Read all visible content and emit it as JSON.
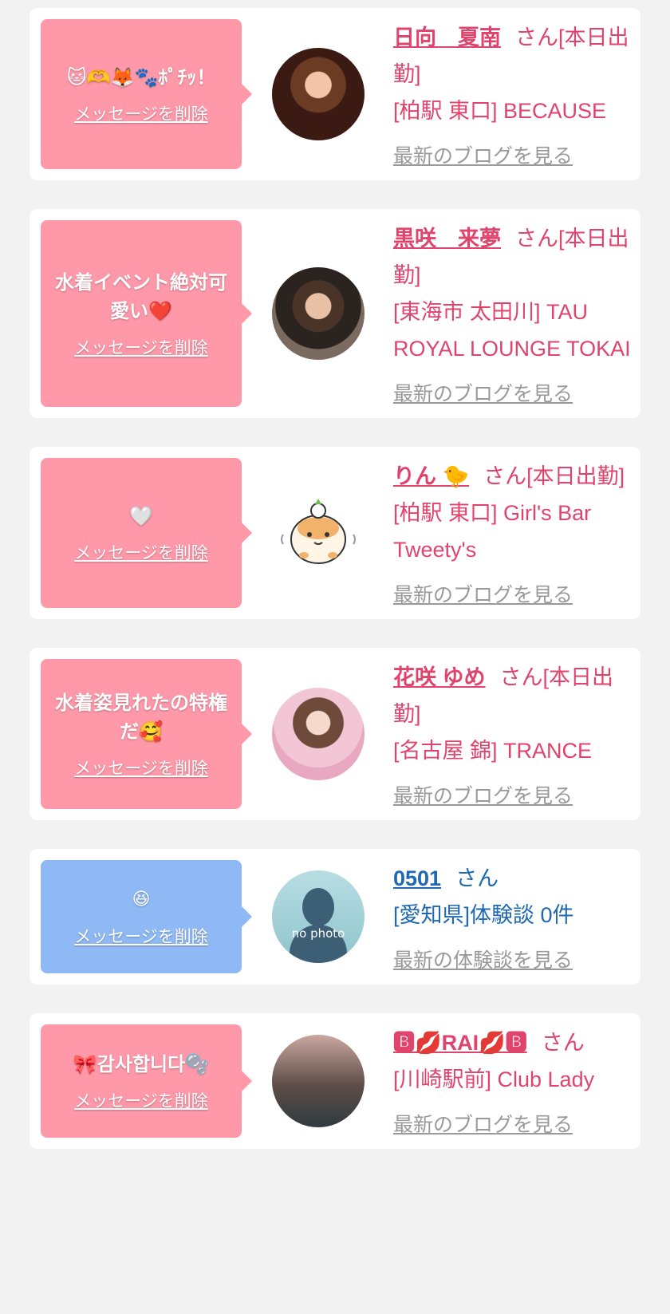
{
  "cards": [
    {
      "bubble_color": "pink",
      "message": "🐱🫶🦊🐾ﾎﾟﾁｯ！",
      "delete_label": "メッセージを削除",
      "avatar_icon": "profile-photo",
      "name": "日向　夏南",
      "suffix": "さん[本日出勤]",
      "shop": "[柏駅 東口] BECAUSE",
      "link": "最新のブログを見る"
    },
    {
      "bubble_color": "pink",
      "message": "水着イベント絶対可愛い❤️",
      "delete_label": "メッセージを削除",
      "avatar_icon": "profile-photo",
      "name": "黒咲　来夢",
      "suffix": "さん[本日出勤]",
      "shop": "[東海市 太田川] TAU ROYAL LOUNGE TOKAI",
      "link": "最新のブログを見る"
    },
    {
      "bubble_color": "pink",
      "message": "🤍",
      "delete_label": "メッセージを削除",
      "avatar_icon": "hamster-mascot",
      "name": "りん 🐤",
      "suffix": "さん[本日出勤]",
      "shop": "[柏駅 東口] Girl's Bar Tweety's",
      "link": "最新のブログを見る"
    },
    {
      "bubble_color": "pink",
      "message": "水着姿見れたの特権だ🥰",
      "delete_label": "メッセージを削除",
      "avatar_icon": "profile-photo",
      "name": "花咲 ゆめ",
      "suffix": "さん[本日出勤]",
      "shop": "[名古屋 錦] TRANCE",
      "link": "最新のブログを見る"
    },
    {
      "bubble_color": "blue",
      "message": "😆",
      "delete_label": "メッセージを削除",
      "avatar_icon": "no-photo",
      "avatar_text": "no photo",
      "name": "0501",
      "suffix": "さん",
      "shop": "[愛知県]体験談 0件",
      "link": "最新の体験談を見る"
    },
    {
      "bubble_color": "pink",
      "message": "🎀감사합니다🫧",
      "delete_label": "メッセージを削除",
      "avatar_icon": "profile-photo",
      "name": "🅱💋RAI💋🅱",
      "suffix": "さん",
      "shop": "[川崎駅前] Club Lady",
      "link": "最新のブログを見る"
    }
  ]
}
